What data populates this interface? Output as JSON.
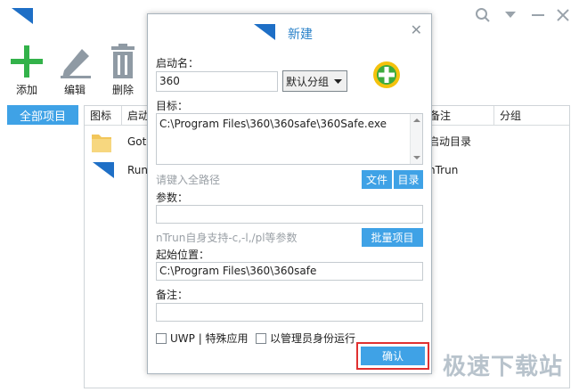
{
  "toolbar": {
    "add_label": "添加",
    "edit_label": "编辑",
    "delete_label": "删除"
  },
  "sidebar": {
    "items": [
      {
        "label": "全部项目"
      }
    ]
  },
  "list": {
    "columns": [
      {
        "label": "图标"
      },
      {
        "label": "启动"
      },
      {
        "label": "备注"
      },
      {
        "label": "分组"
      }
    ],
    "rows": [
      {
        "name": "Goto",
        "note": "启动目录"
      },
      {
        "name": "Run",
        "note": "nTrun"
      }
    ]
  },
  "dialog": {
    "title": "新建",
    "name_label": "启动名：",
    "name_value": "360",
    "group_value": "默认分组",
    "target_label": "目标：",
    "target_value": "C:\\Program Files\\360\\360safe\\360Safe.exe",
    "target_hint": "请键入全路径",
    "file_button": "文件",
    "dir_button": "目录",
    "params_label": "参数：",
    "params_value": "",
    "params_hint": "nTrun自身支持-c,-l,/pl等参数",
    "batch_button": "批量项目",
    "startdir_label": "起始位置：",
    "startdir_value": "C:\\Program Files\\360\\360safe",
    "note_label": "备注：",
    "note_value": "",
    "uwp_label": "UWP | 特殊应用",
    "admin_label": "以管理员身份运行",
    "confirm_button": "确认"
  },
  "watermark": "极速下载站",
  "colors": {
    "accent": "#3fa2e6",
    "add_green": "#33b24a",
    "highlight_red": "#e03030"
  }
}
